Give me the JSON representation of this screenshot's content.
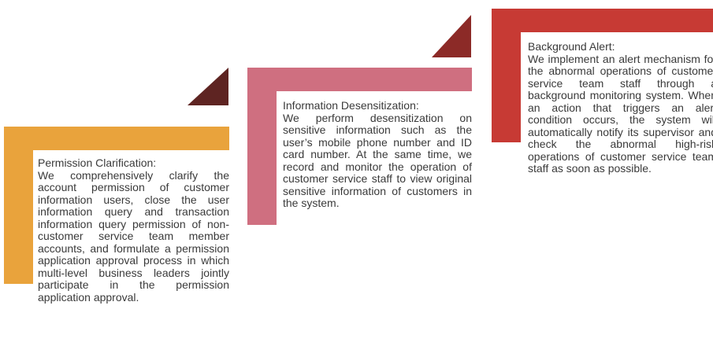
{
  "colors": {
    "step1": "#e9a33c",
    "step2": "#cf6f80",
    "step3": "#c73a34",
    "step1_corner": "#5e2422",
    "step2_corner": "#8c2a27"
  },
  "steps": [
    {
      "title": "Permission Clarification:",
      "body": "We comprehensively clarify the account permission of customer information users, close the user information query and transaction information query permission of non-customer service team member accounts, and formulate a permission application approval process in which multi-level business leaders jointly participate in the permission application approval."
    },
    {
      "title": "Information Desensitization:",
      "body": "We perform desensitization on sensitive information such as the user’s mobile phone number and ID card number. At the same time, we record and monitor the operation of customer service staff to view original sensitive information of customers in the system."
    },
    {
      "title": "Background Alert:",
      "body": "We implement an alert mechanism for the abnormal operations of customer service team staff through a background monitoring system. When an action that triggers an alert condition occurs, the system will automatically notify its supervisor and check the abnormal high-risk operations of customer service team staff as soon as possible."
    }
  ]
}
